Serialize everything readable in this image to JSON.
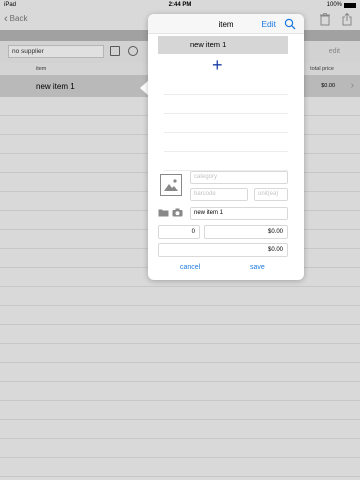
{
  "status": {
    "device": "iPad",
    "time": "2:44 PM",
    "battery": "100%"
  },
  "nav": {
    "back_label": "Back"
  },
  "filter": {
    "supplier_value": "no supplier",
    "edit_label": "edit"
  },
  "columns": {
    "item": "item",
    "total_price": "total price"
  },
  "rows": [
    {
      "name": "new item 1",
      "total": "$0.00"
    }
  ],
  "popover": {
    "title": "item",
    "edit_label": "Edit",
    "list_items": [
      "new item 1"
    ],
    "add_symbol": "+",
    "category_placeholder": "category",
    "barcode_placeholder": "barcode",
    "unit_placeholder": "unit(ea)",
    "name_value": "new item 1",
    "quantity_value": "0",
    "unit_price_value": "$0.00",
    "total_value": "$0.00",
    "cancel_label": "cancel",
    "save_label": "save"
  },
  "colors": {
    "accent": "#1e7ae0",
    "plus": "#1b3fa8",
    "selected_row": "#d3d3d3"
  }
}
